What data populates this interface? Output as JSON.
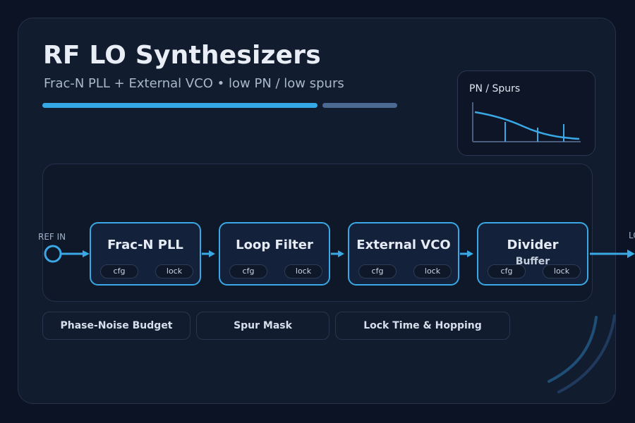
{
  "header": {
    "title": "RF LO Synthesizers",
    "subtitle": "Frac-N PLL + External VCO • low PN / low spurs"
  },
  "mini_chart": {
    "title": "PN / Spurs"
  },
  "diagram": {
    "input_label": "REF IN",
    "output_label": "LO",
    "blocks": [
      {
        "title": "Frac-N PLL",
        "subtitle": "",
        "cfg_label": "cfg",
        "lock_label": "lock"
      },
      {
        "title": "Loop Filter",
        "subtitle": "",
        "cfg_label": "cfg",
        "lock_label": "lock"
      },
      {
        "title": "External VCO",
        "subtitle": "",
        "cfg_label": "cfg",
        "lock_label": "lock"
      },
      {
        "title": "Divider",
        "subtitle": "Buffer",
        "cfg_label": "cfg",
        "lock_label": "lock"
      }
    ]
  },
  "tabs": [
    {
      "label": "Phase-Noise Budget"
    },
    {
      "label": "Spur Mask"
    },
    {
      "label": "Lock Time & Hopping"
    }
  ],
  "colors": {
    "accent": "#35a9e6",
    "accent_muted": "#4a6a92",
    "background": "#0c1324",
    "card": "#121c2f"
  }
}
